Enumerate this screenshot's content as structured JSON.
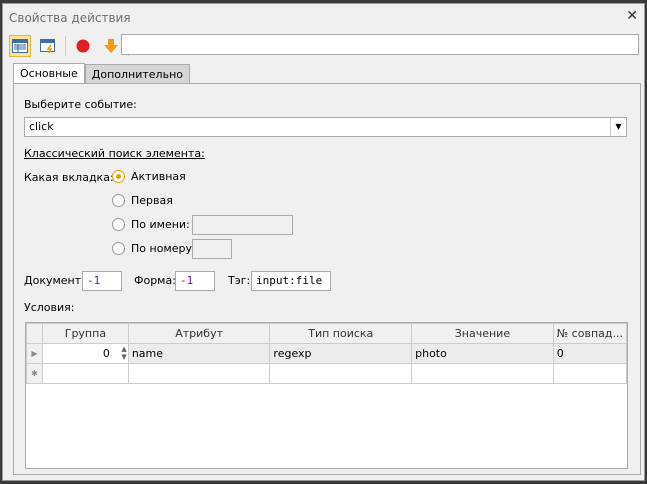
{
  "title": "Свойства действия",
  "tabs": [
    "Основные",
    "Дополнительно"
  ],
  "event_label": "Выберите событие:",
  "event_value": "click",
  "classic_label": "Классический поиск элемента:",
  "which_tab_label": "Какая вкладка:",
  "radios": [
    "Активная",
    "Первая",
    "По имени:",
    "По номеру:"
  ],
  "doc_label": "Документ:",
  "doc_value": "-1",
  "form_label": "Форма:",
  "form_value": "-1",
  "tag_label": "Тэг:",
  "tag_value": "input:file",
  "conditions_label": "Условия:",
  "columns": [
    "Группа",
    "Атрибут",
    "Тип поиска",
    "Значение",
    "№ совпад..."
  ],
  "rows": [
    [
      "0",
      "name",
      "regexp",
      "photo",
      "0"
    ]
  ]
}
